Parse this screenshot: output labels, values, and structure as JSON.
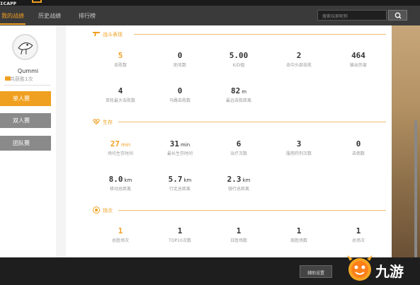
{
  "logo_text": "ɪᴄᴀᴘᴘ",
  "nav": {
    "tabs": [
      {
        "label": "我的战绩",
        "active": true
      },
      {
        "label": "历史战绩",
        "active": false
      },
      {
        "label": "排行榜",
        "active": false
      }
    ],
    "search_placeholder": "搜索玩家昵称"
  },
  "sidebar": {
    "username": "Qummi",
    "wins_text": "共获胜1次",
    "modes": [
      {
        "label": "单人赛",
        "active": true
      },
      {
        "label": "双人赛",
        "active": false
      },
      {
        "label": "团队赛",
        "active": false
      }
    ]
  },
  "sections": {
    "combat": {
      "title": "战斗表现",
      "icon": "gun-icon",
      "row1": [
        {
          "value": "5",
          "unit": "",
          "label": "击败数",
          "highlight": true
        },
        {
          "value": "0",
          "unit": "",
          "label": "助攻数",
          "highlight": false
        },
        {
          "value": "5.00",
          "unit": "",
          "label": "K/D值",
          "highlight": false
        },
        {
          "value": "2",
          "unit": "",
          "label": "击中头部击败",
          "highlight": false
        },
        {
          "value": "464",
          "unit": "",
          "label": "输出伤害",
          "highlight": false
        }
      ],
      "row2": [
        {
          "value": "4",
          "unit": "",
          "label": "单轮最大击败数",
          "highlight": false
        },
        {
          "value": "0",
          "unit": "",
          "label": "马路击败数",
          "highlight": false
        },
        {
          "value": "82",
          "unit": "m",
          "label": "最远击败距离",
          "highlight": false
        }
      ]
    },
    "survival": {
      "title": "生存",
      "icon": "heartbeat-icon",
      "row1": [
        {
          "value": "27",
          "unit": "min",
          "label": "场均生存时间",
          "highlight": true
        },
        {
          "value": "31",
          "unit": "min",
          "label": "最长生存时间",
          "highlight": false
        },
        {
          "value": "6",
          "unit": "",
          "label": "治疗次数",
          "highlight": false
        },
        {
          "value": "3",
          "unit": "",
          "label": "服用药剂次数",
          "highlight": false
        },
        {
          "value": "0",
          "unit": "",
          "label": "击倒数",
          "highlight": false
        }
      ],
      "row2": [
        {
          "value": "8.0",
          "unit": "km",
          "label": "移动总距离",
          "highlight": false
        },
        {
          "value": "5.7",
          "unit": "km",
          "label": "行走总距离",
          "highlight": false
        },
        {
          "value": "2.3",
          "unit": "km",
          "label": "骑行总距离",
          "highlight": false
        }
      ]
    },
    "matches": {
      "title": "场次",
      "icon": "trophy-icon",
      "row1": [
        {
          "value": "1",
          "unit": "",
          "label": "总胜场次",
          "highlight": true
        },
        {
          "value": "1",
          "unit": "",
          "label": "TOP10次数",
          "highlight": false
        },
        {
          "value": "1",
          "unit": "",
          "label": "日胜场数",
          "highlight": false
        },
        {
          "value": "1",
          "unit": "",
          "label": "周胜场数",
          "highlight": false
        },
        {
          "value": "1",
          "unit": "",
          "label": "总场次",
          "highlight": false
        }
      ]
    }
  },
  "footer": {
    "assist_button": "辅助设置",
    "watermark": "九游"
  },
  "colors": {
    "accent": "#f0a020",
    "topbar": "#3a3a3a",
    "inactive_mode": "#8a8a8a"
  }
}
